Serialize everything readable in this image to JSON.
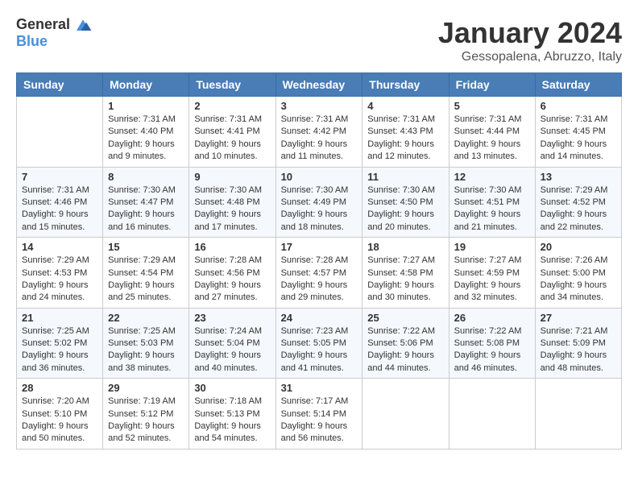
{
  "logo": {
    "general": "General",
    "blue": "Blue"
  },
  "title": "January 2024",
  "subtitle": "Gessopalena, Abruzzo, Italy",
  "days_of_week": [
    "Sunday",
    "Monday",
    "Tuesday",
    "Wednesday",
    "Thursday",
    "Friday",
    "Saturday"
  ],
  "weeks": [
    [
      {
        "day": "",
        "sunrise": "",
        "sunset": "",
        "daylight": ""
      },
      {
        "day": "1",
        "sunrise": "Sunrise: 7:31 AM",
        "sunset": "Sunset: 4:40 PM",
        "daylight": "Daylight: 9 hours and 9 minutes."
      },
      {
        "day": "2",
        "sunrise": "Sunrise: 7:31 AM",
        "sunset": "Sunset: 4:41 PM",
        "daylight": "Daylight: 9 hours and 10 minutes."
      },
      {
        "day": "3",
        "sunrise": "Sunrise: 7:31 AM",
        "sunset": "Sunset: 4:42 PM",
        "daylight": "Daylight: 9 hours and 11 minutes."
      },
      {
        "day": "4",
        "sunrise": "Sunrise: 7:31 AM",
        "sunset": "Sunset: 4:43 PM",
        "daylight": "Daylight: 9 hours and 12 minutes."
      },
      {
        "day": "5",
        "sunrise": "Sunrise: 7:31 AM",
        "sunset": "Sunset: 4:44 PM",
        "daylight": "Daylight: 9 hours and 13 minutes."
      },
      {
        "day": "6",
        "sunrise": "Sunrise: 7:31 AM",
        "sunset": "Sunset: 4:45 PM",
        "daylight": "Daylight: 9 hours and 14 minutes."
      }
    ],
    [
      {
        "day": "7",
        "sunrise": "Sunrise: 7:31 AM",
        "sunset": "Sunset: 4:46 PM",
        "daylight": "Daylight: 9 hours and 15 minutes."
      },
      {
        "day": "8",
        "sunrise": "Sunrise: 7:30 AM",
        "sunset": "Sunset: 4:47 PM",
        "daylight": "Daylight: 9 hours and 16 minutes."
      },
      {
        "day": "9",
        "sunrise": "Sunrise: 7:30 AM",
        "sunset": "Sunset: 4:48 PM",
        "daylight": "Daylight: 9 hours and 17 minutes."
      },
      {
        "day": "10",
        "sunrise": "Sunrise: 7:30 AM",
        "sunset": "Sunset: 4:49 PM",
        "daylight": "Daylight: 9 hours and 18 minutes."
      },
      {
        "day": "11",
        "sunrise": "Sunrise: 7:30 AM",
        "sunset": "Sunset: 4:50 PM",
        "daylight": "Daylight: 9 hours and 20 minutes."
      },
      {
        "day": "12",
        "sunrise": "Sunrise: 7:30 AM",
        "sunset": "Sunset: 4:51 PM",
        "daylight": "Daylight: 9 hours and 21 minutes."
      },
      {
        "day": "13",
        "sunrise": "Sunrise: 7:29 AM",
        "sunset": "Sunset: 4:52 PM",
        "daylight": "Daylight: 9 hours and 22 minutes."
      }
    ],
    [
      {
        "day": "14",
        "sunrise": "Sunrise: 7:29 AM",
        "sunset": "Sunset: 4:53 PM",
        "daylight": "Daylight: 9 hours and 24 minutes."
      },
      {
        "day": "15",
        "sunrise": "Sunrise: 7:29 AM",
        "sunset": "Sunset: 4:54 PM",
        "daylight": "Daylight: 9 hours and 25 minutes."
      },
      {
        "day": "16",
        "sunrise": "Sunrise: 7:28 AM",
        "sunset": "Sunset: 4:56 PM",
        "daylight": "Daylight: 9 hours and 27 minutes."
      },
      {
        "day": "17",
        "sunrise": "Sunrise: 7:28 AM",
        "sunset": "Sunset: 4:57 PM",
        "daylight": "Daylight: 9 hours and 29 minutes."
      },
      {
        "day": "18",
        "sunrise": "Sunrise: 7:27 AM",
        "sunset": "Sunset: 4:58 PM",
        "daylight": "Daylight: 9 hours and 30 minutes."
      },
      {
        "day": "19",
        "sunrise": "Sunrise: 7:27 AM",
        "sunset": "Sunset: 4:59 PM",
        "daylight": "Daylight: 9 hours and 32 minutes."
      },
      {
        "day": "20",
        "sunrise": "Sunrise: 7:26 AM",
        "sunset": "Sunset: 5:00 PM",
        "daylight": "Daylight: 9 hours and 34 minutes."
      }
    ],
    [
      {
        "day": "21",
        "sunrise": "Sunrise: 7:25 AM",
        "sunset": "Sunset: 5:02 PM",
        "daylight": "Daylight: 9 hours and 36 minutes."
      },
      {
        "day": "22",
        "sunrise": "Sunrise: 7:25 AM",
        "sunset": "Sunset: 5:03 PM",
        "daylight": "Daylight: 9 hours and 38 minutes."
      },
      {
        "day": "23",
        "sunrise": "Sunrise: 7:24 AM",
        "sunset": "Sunset: 5:04 PM",
        "daylight": "Daylight: 9 hours and 40 minutes."
      },
      {
        "day": "24",
        "sunrise": "Sunrise: 7:23 AM",
        "sunset": "Sunset: 5:05 PM",
        "daylight": "Daylight: 9 hours and 41 minutes."
      },
      {
        "day": "25",
        "sunrise": "Sunrise: 7:22 AM",
        "sunset": "Sunset: 5:06 PM",
        "daylight": "Daylight: 9 hours and 44 minutes."
      },
      {
        "day": "26",
        "sunrise": "Sunrise: 7:22 AM",
        "sunset": "Sunset: 5:08 PM",
        "daylight": "Daylight: 9 hours and 46 minutes."
      },
      {
        "day": "27",
        "sunrise": "Sunrise: 7:21 AM",
        "sunset": "Sunset: 5:09 PM",
        "daylight": "Daylight: 9 hours and 48 minutes."
      }
    ],
    [
      {
        "day": "28",
        "sunrise": "Sunrise: 7:20 AM",
        "sunset": "Sunset: 5:10 PM",
        "daylight": "Daylight: 9 hours and 50 minutes."
      },
      {
        "day": "29",
        "sunrise": "Sunrise: 7:19 AM",
        "sunset": "Sunset: 5:12 PM",
        "daylight": "Daylight: 9 hours and 52 minutes."
      },
      {
        "day": "30",
        "sunrise": "Sunrise: 7:18 AM",
        "sunset": "Sunset: 5:13 PM",
        "daylight": "Daylight: 9 hours and 54 minutes."
      },
      {
        "day": "31",
        "sunrise": "Sunrise: 7:17 AM",
        "sunset": "Sunset: 5:14 PM",
        "daylight": "Daylight: 9 hours and 56 minutes."
      },
      {
        "day": "",
        "sunrise": "",
        "sunset": "",
        "daylight": ""
      },
      {
        "day": "",
        "sunrise": "",
        "sunset": "",
        "daylight": ""
      },
      {
        "day": "",
        "sunrise": "",
        "sunset": "",
        "daylight": ""
      }
    ]
  ]
}
